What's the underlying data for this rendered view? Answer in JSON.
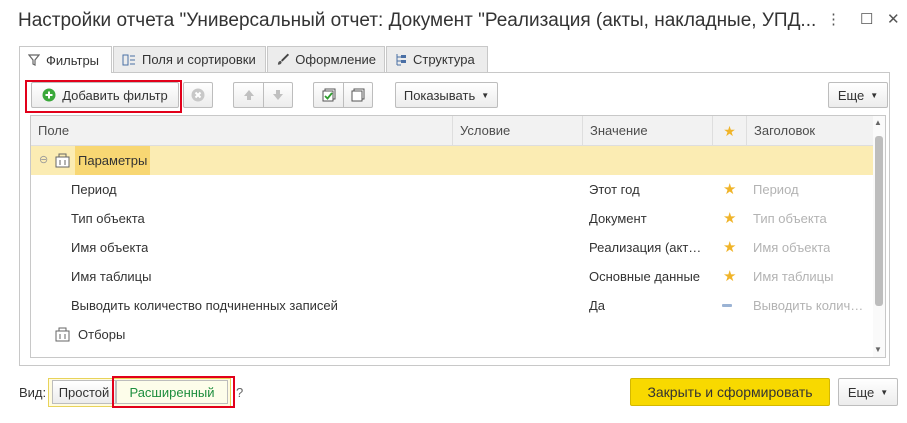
{
  "window": {
    "title": "Настройки отчета \"Универсальный отчет: Документ \"Реализация (акты, накладные, УПД...",
    "more_icon": "⋮",
    "maximize_icon": "☐",
    "close_icon": "✕"
  },
  "tabs": [
    {
      "label": "Фильтры",
      "icon": "filter-icon"
    },
    {
      "label": "Поля и сортировки",
      "icon": "fields-icon"
    },
    {
      "label": "Оформление",
      "icon": "brush-icon"
    },
    {
      "label": "Структура",
      "icon": "structure-icon"
    }
  ],
  "toolbar": {
    "add_filter": "Добавить фильтр",
    "show": "Показывать",
    "more": "Еще"
  },
  "grid": {
    "columns": [
      "Поле",
      "Условие",
      "Значение",
      "★",
      "Заголовок"
    ],
    "group_label": "Параметры",
    "rows": [
      {
        "field": "Период",
        "value": "Этот год",
        "title": "Период"
      },
      {
        "field": "Тип объекта",
        "value": "Документ",
        "title": "Тип объекта"
      },
      {
        "field": "Имя объекта",
        "value": "Реализация (акт…",
        "title": "Имя объекта"
      },
      {
        "field": "Имя таблицы",
        "value": "Основные данные",
        "title": "Имя таблицы"
      },
      {
        "field": "Выводить количество подчиненных записей",
        "value": "Да",
        "title": "Выводить колич…"
      }
    ],
    "filters_label": "Отборы"
  },
  "footer": {
    "view_label": "Вид:",
    "simple": "Простой",
    "advanced": "Расширенный",
    "help": "?",
    "generate": "Закрыть и сформировать",
    "more": "Еще"
  },
  "colors": {
    "accent_yellow": "#f8d900",
    "highlight_red": "#e2001a",
    "group_row": "#fbecb3",
    "green_text": "#1e8e3e"
  }
}
